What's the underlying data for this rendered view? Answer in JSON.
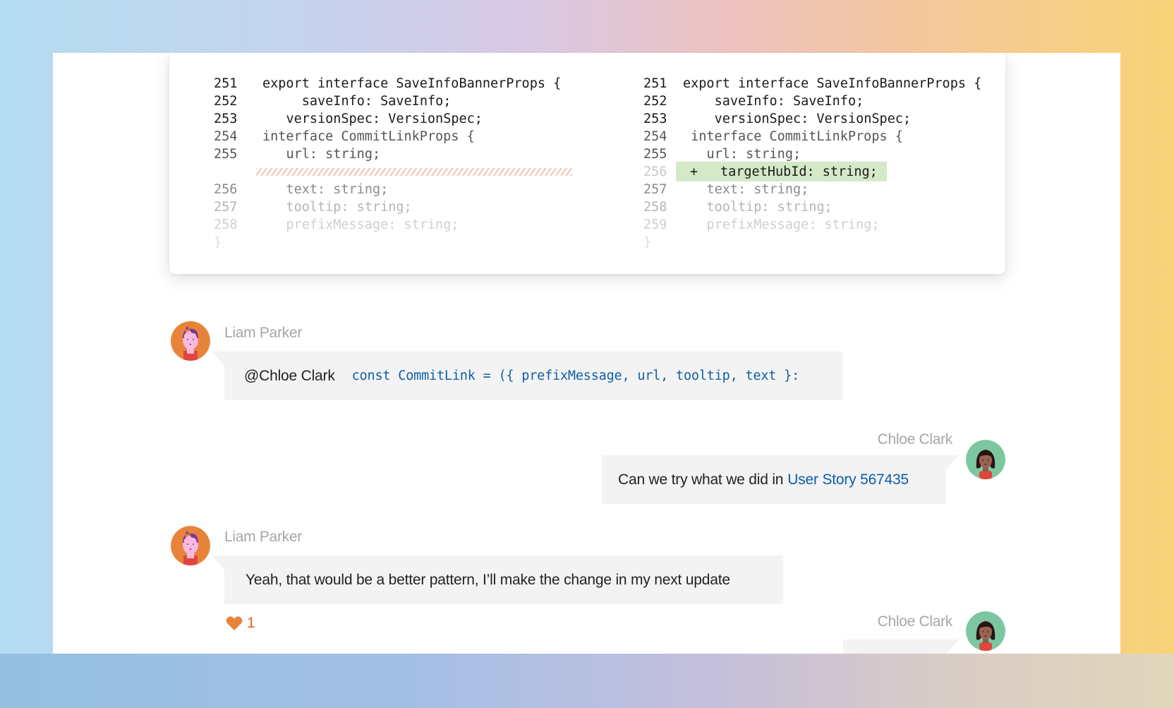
{
  "colors": {
    "added_line_bg": "#d4e9c8",
    "deleted_hatch": "#f2b8a6",
    "bubble_bg": "#f3f3f3",
    "link": "#0b5cad",
    "inline_code": "#0f5fa8",
    "reaction": "#e8843a",
    "author_name": "#a6a6a6",
    "liam_avatar_bg": "#e8843a",
    "chloe_avatar_bg": "#7cc7a0"
  },
  "diff": {
    "left": {
      "lines": [
        {
          "num": "251",
          "code": "export interface SaveInfoBannerProps {",
          "indent": 0
        },
        {
          "num": "252",
          "code": "saveInfo: SaveInfo;",
          "indent": 5
        },
        {
          "num": "253",
          "code": "versionSpec: VersionSpec;",
          "indent": 3
        },
        {
          "num": "254",
          "code": "interface CommitLinkProps {",
          "indent": 0
        },
        {
          "num": "255",
          "code": "url: string;",
          "indent": 3
        },
        {
          "num": "",
          "code": "",
          "deleted_placeholder": true
        },
        {
          "num": "256",
          "code": "text: string;",
          "indent": 3
        },
        {
          "num": "257",
          "code": "tooltip: string;",
          "indent": 3
        },
        {
          "num": "258",
          "code": "prefixMessage: string;",
          "indent": 3
        },
        {
          "num": "}",
          "code": ""
        }
      ]
    },
    "right": {
      "lines": [
        {
          "num": "251",
          "code": "export interface SaveInfoBannerProps {",
          "indent": 0
        },
        {
          "num": "252",
          "code": "saveInfo: SaveInfo;",
          "indent": 4
        },
        {
          "num": "253",
          "code": "versionSpec: VersionSpec;",
          "indent": 4
        },
        {
          "num": "254",
          "code": "interface CommitLinkProps {",
          "indent": 1
        },
        {
          "num": "255",
          "code": "url: string;",
          "indent": 3
        },
        {
          "num": "256",
          "code": "targetHubId: string;",
          "added": true,
          "marker": "+"
        },
        {
          "num": "257",
          "code": "text: string;",
          "indent": 3
        },
        {
          "num": "258",
          "code": "tooltip: string;",
          "indent": 3
        },
        {
          "num": "259",
          "code": "prefixMessage: string;",
          "indent": 3
        },
        {
          "num": "}",
          "code": ""
        }
      ]
    }
  },
  "comments": [
    {
      "author": "Liam Parker",
      "avatar": "liam-avatar",
      "mention": "@Chloe Clark",
      "code": "const CommitLink = ({ prefixMessage, url, tooltip, text }:"
    },
    {
      "author": "Chloe Clark",
      "avatar": "chloe-avatar",
      "text": "Can we try what we did in",
      "link": "User Story 567435"
    },
    {
      "author": "Liam Parker",
      "avatar": "liam-avatar",
      "text": "Yeah, that would be a better pattern, I’ll make the change in my next update",
      "reaction": {
        "icon": "heart-icon",
        "count": "1"
      }
    },
    {
      "author": "Chloe Clark",
      "avatar": "chloe-avatar",
      "text": ""
    }
  ]
}
